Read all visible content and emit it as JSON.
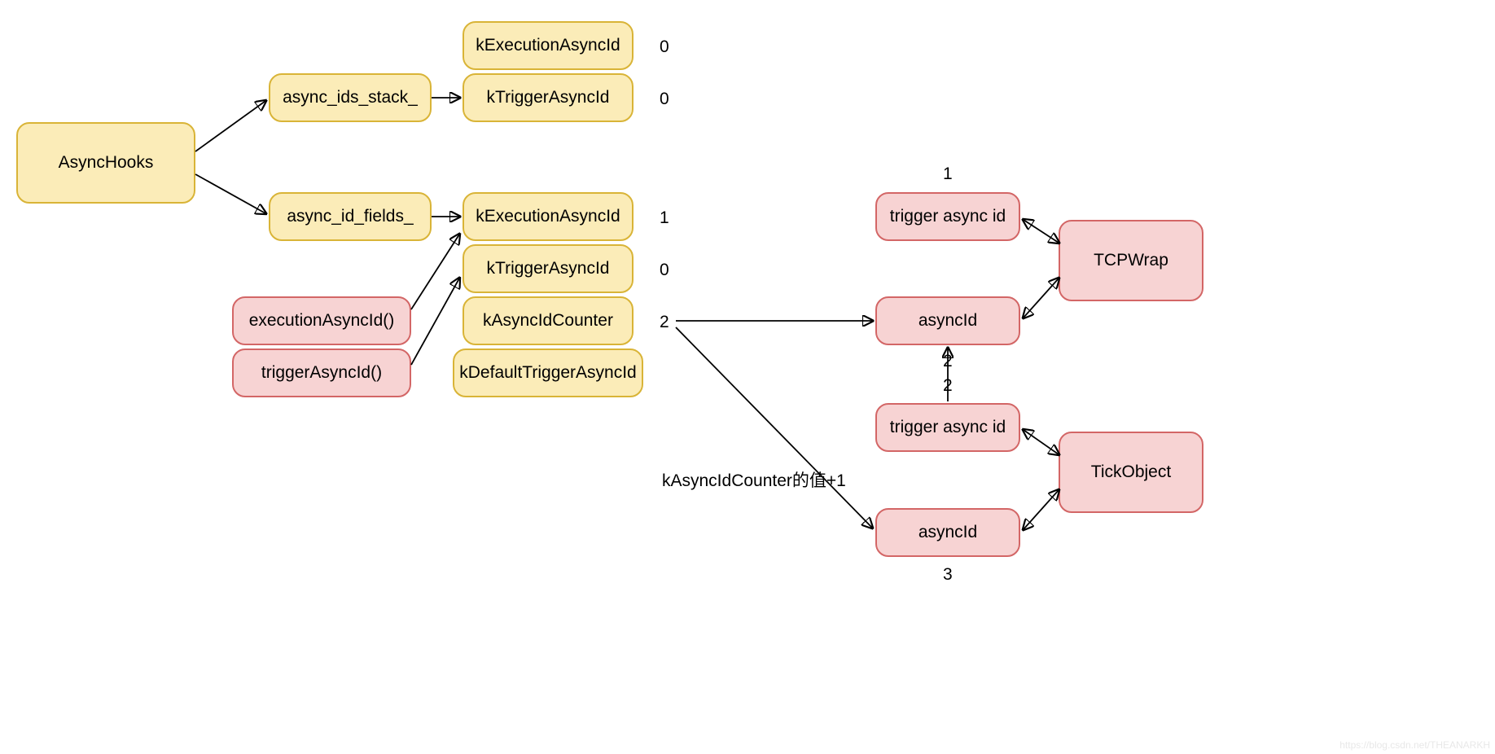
{
  "nodes": {
    "asyncHooks": "AsyncHooks",
    "asyncIdsStack": "async_ids_stack_",
    "asyncIdFields": "async_id_fields_",
    "kExecutionAsyncId1": "kExecutionAsyncId",
    "kTriggerAsyncId1": "kTriggerAsyncId",
    "kExecutionAsyncId2": "kExecutionAsyncId",
    "kTriggerAsyncId2": "kTriggerAsyncId",
    "kAsyncIdCounter": "kAsyncIdCounter",
    "kDefaultTriggerAsyncId": "kDefaultTriggerAsyncId",
    "executionAsyncIdFn": "executionAsyncId()",
    "triggerAsyncIdFn": "triggerAsyncId()",
    "triggerAsyncId_tcp": "trigger async id",
    "asyncId_tcp": "asyncId",
    "triggerAsyncId_tick": "trigger async id",
    "asyncId_tick": "asyncId",
    "tcpWrap": "TCPWrap",
    "tickObject": "TickObject"
  },
  "values": {
    "v_kExec1": "0",
    "v_kTrig1": "0",
    "v_kExec2": "1",
    "v_kTrig2": "0",
    "v_kCounter": "2",
    "v_trigger_tcp": "1",
    "v_async_tcp_above": "2",
    "v_trigger_tick_above": "2",
    "v_async_tick_below": "3"
  },
  "edgeLabel": "kAsyncIdCounter的值+1",
  "watermark": "https://blog.csdn.net/THEANARKH"
}
